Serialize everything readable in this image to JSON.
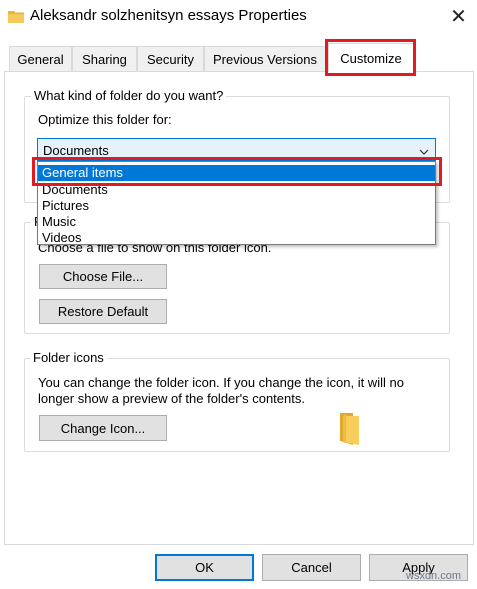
{
  "window": {
    "title": "Aleksandr solzhenitsyn essays Properties",
    "icon": "folder-icon",
    "close_glyph": "✕"
  },
  "tabs": [
    {
      "label": "General"
    },
    {
      "label": "Sharing"
    },
    {
      "label": "Security"
    },
    {
      "label": "Previous Versions"
    },
    {
      "label": "Customize",
      "active": true
    }
  ],
  "folder_type": {
    "group_label": "What kind of folder do you want?",
    "optimize_label": "Optimize this folder for:",
    "selected_value": "Documents",
    "options": [
      "General items",
      "Documents",
      "Pictures",
      "Music",
      "Videos"
    ],
    "highlighted_option": "General items"
  },
  "folder_pictures": {
    "group_label_partial": "F",
    "hint_partial": "Choose a file to show on this folder icon.",
    "choose_file_button": "Choose File...",
    "restore_default_button": "Restore Default"
  },
  "folder_icons": {
    "group_label": "Folder icons",
    "description_line1": "You can change the folder icon. If you change the icon, it will no",
    "description_line2": "longer show a preview of the folder's contents.",
    "change_icon_button": "Change Icon..."
  },
  "buttons": {
    "ok": "OK",
    "cancel": "Cancel",
    "apply": "Apply"
  },
  "watermark": "wsxdn.com",
  "colors": {
    "accent": "#0078d7",
    "highlight_red": "#e01b22",
    "folder_yellow": "#f5c342"
  }
}
